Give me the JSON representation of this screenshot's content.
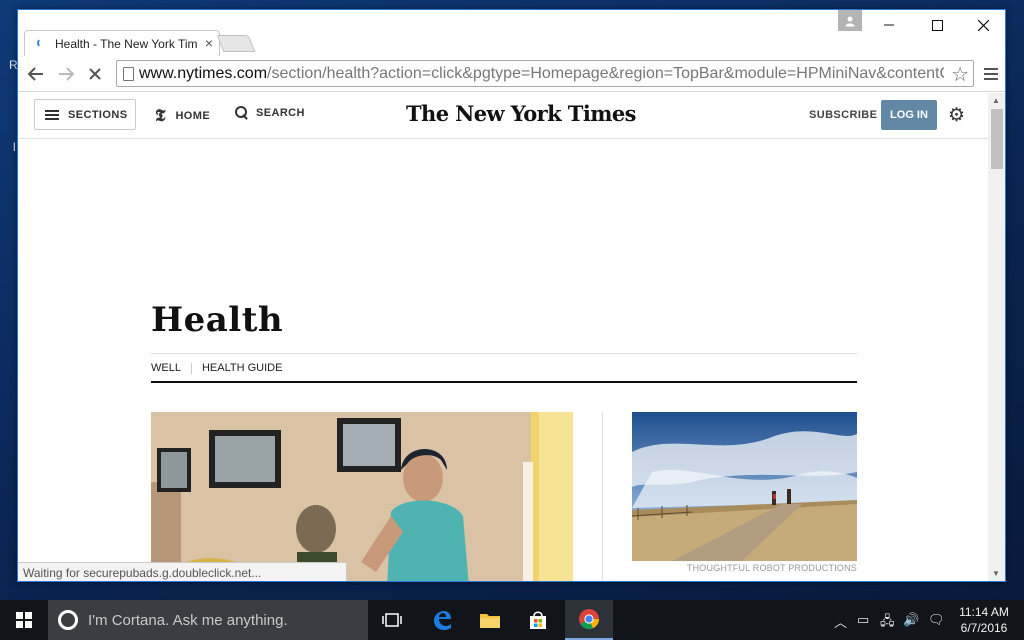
{
  "desktop": {
    "left_fragment": "R",
    "left_fragment2": "l"
  },
  "browser": {
    "tab": {
      "title": "Health - The New York Times",
      "close_label": "×"
    },
    "url": {
      "host": "www.nytimes.com",
      "path": "/section/health?action=click&pgtype=Homepage&region=TopBar&module=HPMiniNav&contentCollection=Health"
    },
    "status_text": "Waiting for securepubads.g.doubleclick.net..."
  },
  "nyt": {
    "sections_label": "SECTIONS",
    "home_label": "HOME",
    "home_logo": "𝕿",
    "search_label": "SEARCH",
    "masthead": "The New York Times",
    "subscribe_label": "SUBSCRIBE",
    "login_label": "LOG IN",
    "section_title": "Health",
    "subnav": [
      "WELL",
      "HEALTH GUIDE"
    ],
    "photo_credit": "THOUGHTFUL ROBOT PRODUCTIONS"
  },
  "taskbar": {
    "cortana_placeholder": "I'm Cortana. Ask me anything.",
    "time": "11:14 AM",
    "date": "6/7/2016"
  },
  "colors": {
    "login_bg": "#6288a5",
    "accent": "#2b79d8",
    "taskbar_bg": "#111419"
  }
}
